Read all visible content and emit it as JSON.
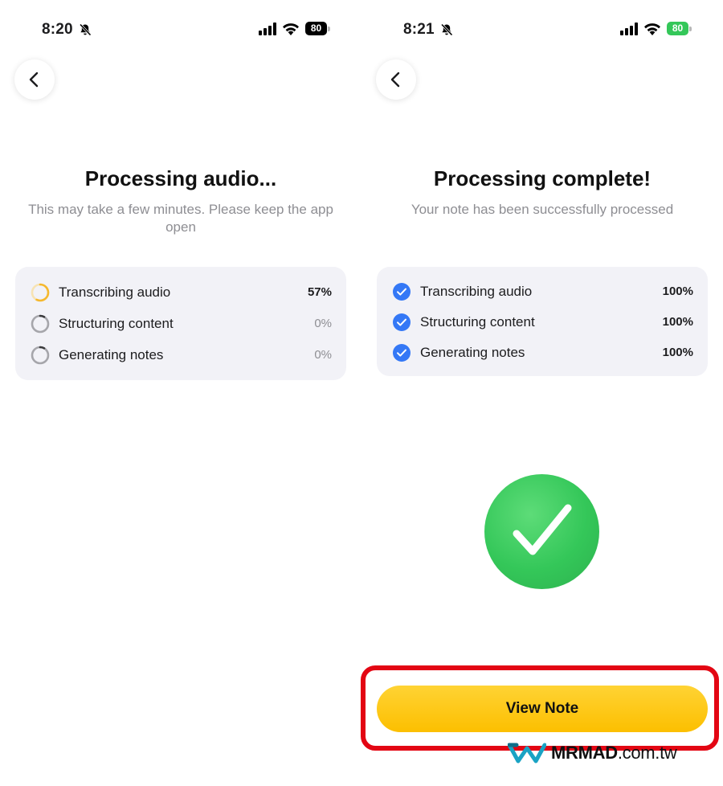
{
  "left_screen": {
    "status": {
      "time": "8:20",
      "battery": "80"
    },
    "title": "Processing audio...",
    "subtitle": "This may take a few minutes. Please keep the app open",
    "steps": [
      {
        "label": "Transcribing audio",
        "percent": "57%",
        "progress": 0.57,
        "state": "in-progress"
      },
      {
        "label": "Structuring content",
        "percent": "0%",
        "progress": 0,
        "state": "pending"
      },
      {
        "label": "Generating notes",
        "percent": "0%",
        "progress": 0,
        "state": "pending"
      }
    ]
  },
  "right_screen": {
    "status": {
      "time": "8:21",
      "battery": "80"
    },
    "title": "Processing complete!",
    "subtitle": "Your note has been successfully processed",
    "steps": [
      {
        "label": "Transcribing audio",
        "percent": "100%",
        "state": "done"
      },
      {
        "label": "Structuring content",
        "percent": "100%",
        "state": "done"
      },
      {
        "label": "Generating notes",
        "percent": "100%",
        "state": "done"
      }
    ],
    "view_note_label": "View Note"
  },
  "watermark": {
    "brand": "MRMAD",
    "suffix": ".com.tw"
  },
  "colors": {
    "accent_yellow": "#fcbf00",
    "progress_orange": "#f5b82e",
    "check_blue": "#3478f6",
    "success_green": "#34c759",
    "highlight_red": "#e30613",
    "card_bg": "#f2f2f7",
    "muted_text": "#8e8e93"
  },
  "icons": {
    "back": "chevron-left-icon",
    "mute": "bell-slash-icon",
    "signal": "cellular-signal-icon",
    "wifi": "wifi-icon",
    "battery": "battery-icon",
    "done": "check-circle-icon",
    "success": "checkmark-icon"
  }
}
